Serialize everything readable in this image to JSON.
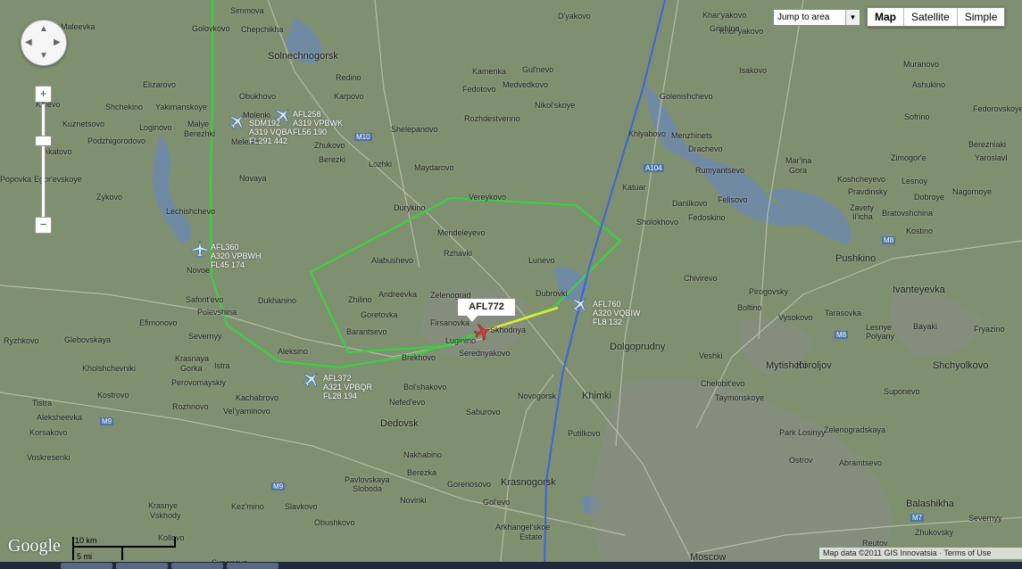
{
  "controls": {
    "jump_label": "Jump to area",
    "map_types": [
      "Map",
      "Satellite",
      "Simple"
    ],
    "zoom_in": "+",
    "zoom_out": "−"
  },
  "flights": [
    {
      "callsign": "AFL258",
      "type": "A319 VPBWK",
      "info": "FL56 190"
    },
    {
      "callsign": "SDM192",
      "type": "A319 VQBA",
      "info": "FL291 442"
    },
    {
      "callsign": "AFL360",
      "type": "A320 VPBWH",
      "info": "FL45 174"
    },
    {
      "callsign": "AFL760",
      "type": "A320 VQBIW",
      "info": "FL8 132"
    },
    {
      "callsign": "AFL372",
      "type": "A321 VPBQR",
      "info": "FL28 194"
    }
  ],
  "selected_flight": "AFL772",
  "places": [
    "Maleevka",
    "Simmova",
    "D'yakovo",
    "Khar'yakovo",
    "Khor'yakovo",
    "Golovkovo",
    "Chepchikha",
    "Grishino",
    "Solnechnogorsk",
    "Elizarovo",
    "Redino",
    "Kamenka",
    "Gul'nevo",
    "Isakovo",
    "Muranovo",
    "Fedotovo",
    "Medvedkovo",
    "Ashukino",
    "Obukhovo",
    "Karpovo",
    "Golenishchevo",
    "Kolevo",
    "Shchekino",
    "Yakimanskoye",
    "Molenki",
    "Kuznetsovo",
    "Loginovo",
    "Malye",
    "Nikol'skoye",
    "Rozhdestvenno",
    "Sofrino",
    "Fedorovskoye",
    "Berezhki",
    "Melenki",
    "Podzhigorodovo",
    "Shelepanovo",
    "Khlyabovo",
    "Menzhinets",
    "Akatovo",
    "Zhukovo",
    "Drachevo",
    "Berezniaki",
    "Berezki",
    "Lozhki",
    "Maydarovo",
    "Mar'ina",
    "Gora",
    "Zimogor'e",
    "Rumyantsevo",
    "Yaroslavl",
    "Popovka",
    "Egor'evskoye",
    "Novaya",
    "Katuar",
    "Koshcheyevo",
    "Lesnoy",
    "Pravdinsky",
    "Dobroye",
    "Nagornoye",
    "Zykovo",
    "Durykino",
    "Vereykovo",
    "Danilkovo",
    "Felisovo",
    "Zavety",
    "Il'icha",
    "Bratovshchina",
    "Lechishchevo",
    "Sholokhovo",
    "Fedoskino",
    "Mendeleyevo",
    "Kostino",
    "Rzhavki",
    "Alabushevo",
    "Lunevo",
    "Pushkino",
    "Novoe",
    "Chivirevo",
    "Ivanteyevka",
    "Zhilino",
    "Andreevka",
    "Zelenograd",
    "Dubrovki",
    "Pirogovsky",
    "Safont'evo",
    "Dukhanino",
    "Boltino",
    "Polevshina",
    "Goretovka",
    "Firsanovka",
    "Skhodnya",
    "Tarasovka",
    "Efimonovo",
    "Barantsevo",
    "Vysokovo",
    "Lesnye",
    "Polyany",
    "Bayaki",
    "Fryazino",
    "Severnyy",
    "Luginino",
    "Ryzhkovo",
    "Glebovskaya",
    "Aleksino",
    "Brekhovo",
    "Serednyakovo",
    "Dolgoprudny",
    "Koroljov",
    "Mytishchi",
    "Shchyolkovo",
    "Krasnaya",
    "Gorka",
    "Istra",
    "Kholshchevniki",
    "Veshki",
    "Chelobit'evo",
    "Perovomayskiy",
    "Bol'shakovo",
    "Novogorsk",
    "Khimki",
    "Taymonskoye",
    "Suponevo",
    "Kostrovo",
    "Kachabrovo",
    "Tistra",
    "Nefed'evo",
    "Rozhnovo",
    "Vel'yaminovo",
    "Saburovo",
    "Dedovsk",
    "Putilkovo",
    "Aleksheevka",
    "Korsakovo",
    "Zelenogradskaya",
    "Park Losinyy",
    "Ostrov",
    "Voskresenki",
    "Nakhabino",
    "Abramtsevo",
    "Berezka",
    "Pavlovskaya",
    "Sloboda",
    "Gorenosovo",
    "Krasnogorsk",
    "Novinki",
    "Balashikha",
    "Krasnye",
    "Vskhody",
    "Kez'mino",
    "Slavkovo",
    "Gol'evo",
    "Severnyy",
    "Obushkovo",
    "Arkhangel'skoe",
    "Estate",
    "Kollovo",
    "Zhukovsky",
    "Suponevo",
    "Reutov",
    "Moscow"
  ],
  "roads": [
    "M10",
    "M9",
    "A104",
    "M8",
    "M7"
  ],
  "scale": {
    "km": "10 km",
    "mi": "5 mi"
  },
  "logo": "Google",
  "attribution": "Map data ©2011 GIS Innovatsia · Terms of Use"
}
